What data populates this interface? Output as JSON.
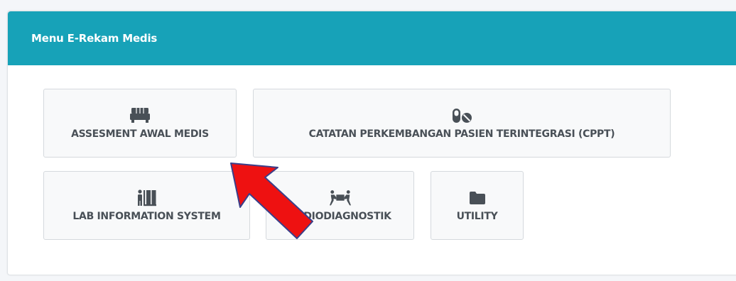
{
  "card": {
    "title": "Menu E-Rekam Medis"
  },
  "buttons": [
    {
      "label": "ASSESMENT AWAL MEDIS",
      "icon": "couch-icon"
    },
    {
      "label": "CATATAN PERKEMBANGAN PASIEN TERINTEGRASI (CPPT)",
      "icon": "pills-icon"
    },
    {
      "label": "LAB INFORMATION SYSTEM",
      "icon": "person-dolly-icon"
    },
    {
      "label": "RADIODIAGNOSTIK",
      "icon": "people-carry-icon"
    },
    {
      "label": "UTILITY",
      "icon": "folder-icon"
    }
  ],
  "colors": {
    "header": "#17a2b8",
    "tile_bg": "#f8f9fa",
    "tile_text": "#495057",
    "annotation_arrow": "#ee1111"
  }
}
